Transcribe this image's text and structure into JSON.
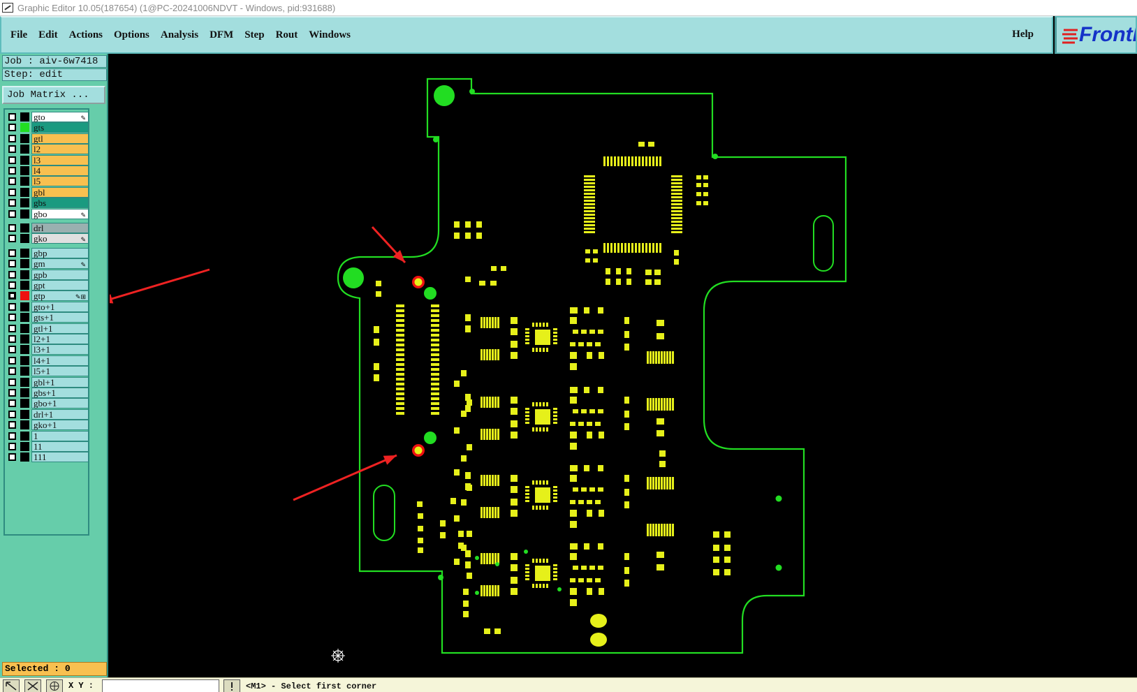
{
  "window": {
    "title": "Graphic Editor 10.05(187654) (1@PC-20241006NDVT - Windows, pid:931688)"
  },
  "menu": {
    "items": [
      "File",
      "Edit",
      "Actions",
      "Options",
      "Analysis",
      "DFM",
      "Step",
      "Rout",
      "Windows"
    ],
    "help": "Help"
  },
  "brand": {
    "logo_text": "Frontl",
    "logo_color": "#1432c8"
  },
  "job": {
    "job_label": "Job : aiv-6w7418",
    "step_label": "Step: edit",
    "matrix_button": "Job Matrix ..."
  },
  "layers": [
    {
      "name": "gto",
      "color": "#ffffff",
      "swatch": "#000000",
      "mark": "✎"
    },
    {
      "name": "gts",
      "color": "#1a9a80",
      "swatch": "#22dd22"
    },
    {
      "name": "gtl",
      "color": "#f8c050",
      "swatch": "#000000"
    },
    {
      "name": "l2",
      "color": "#f8c050",
      "swatch": "#000000"
    },
    {
      "name": "l3",
      "color": "#f8c050",
      "swatch": "#000000"
    },
    {
      "name": "l4",
      "color": "#f8c050",
      "swatch": "#000000"
    },
    {
      "name": "l5",
      "color": "#f8c050",
      "swatch": "#000000"
    },
    {
      "name": "gbl",
      "color": "#f8c050",
      "swatch": "#000000"
    },
    {
      "name": "gbs",
      "color": "#1a9a80",
      "swatch": "#000000"
    },
    {
      "name": "gbo",
      "color": "#ffffff",
      "swatch": "#000000",
      "mark": "✎"
    },
    {
      "name": "drl",
      "color": "#9ab0b0",
      "swatch": "#000000"
    },
    {
      "name": "gko",
      "color": "#e0e0e0",
      "swatch": "#000000",
      "mark": "✎"
    },
    {
      "name": "gbp",
      "color": "#a3dede",
      "swatch": "#000000"
    },
    {
      "name": "gm",
      "color": "#a3dede",
      "swatch": "#000000",
      "mark": "✎"
    },
    {
      "name": "gpb",
      "color": "#a3dede",
      "swatch": "#000000"
    },
    {
      "name": "gpt",
      "color": "#a3dede",
      "swatch": "#000000"
    },
    {
      "name": "gtp",
      "color": "#a3dede",
      "swatch": "#ee1111",
      "mark": "✎⊞",
      "active": true
    },
    {
      "name": "gto+1",
      "color": "#a3dede",
      "swatch": "#000000"
    },
    {
      "name": "gts+1",
      "color": "#a3dede",
      "swatch": "#000000"
    },
    {
      "name": "gtl+1",
      "color": "#a3dede",
      "swatch": "#000000"
    },
    {
      "name": "l2+1",
      "color": "#a3dede",
      "swatch": "#000000"
    },
    {
      "name": "l3+1",
      "color": "#a3dede",
      "swatch": "#000000"
    },
    {
      "name": "l4+1",
      "color": "#a3dede",
      "swatch": "#000000"
    },
    {
      "name": "l5+1",
      "color": "#a3dede",
      "swatch": "#000000"
    },
    {
      "name": "gbl+1",
      "color": "#a3dede",
      "swatch": "#000000"
    },
    {
      "name": "gbs+1",
      "color": "#a3dede",
      "swatch": "#000000"
    },
    {
      "name": "gbo+1",
      "color": "#a3dede",
      "swatch": "#000000"
    },
    {
      "name": "drl+1",
      "color": "#a3dede",
      "swatch": "#000000"
    },
    {
      "name": "gko+1",
      "color": "#a3dede",
      "swatch": "#000000"
    },
    {
      "name": "1",
      "color": "#a3dede",
      "swatch": "#000000"
    },
    {
      "name": "11",
      "color": "#a3dede",
      "swatch": "#000000"
    },
    {
      "name": "111",
      "color": "#a3dede",
      "swatch": "#000000"
    }
  ],
  "status": {
    "selected": "Selected : 0",
    "xy_label": "X Y :",
    "xy_value": "",
    "message": "<M1> - Select first corner"
  },
  "colors": {
    "outline": "#22dd22",
    "pad": "#e6f01a",
    "marker_ring": "#ee1111",
    "arrow": "#ee2222"
  }
}
